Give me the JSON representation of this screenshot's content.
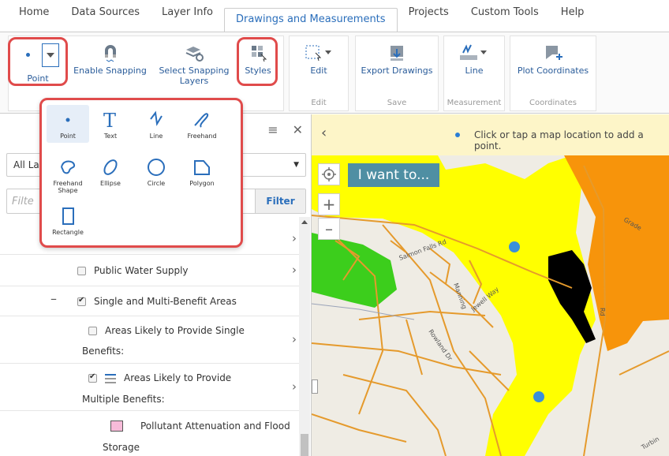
{
  "menu": {
    "tabs": [
      {
        "label": "Home"
      },
      {
        "label": "Data Sources"
      },
      {
        "label": "Layer Info"
      },
      {
        "label": "Drawings and Measurements"
      },
      {
        "label": "Projects"
      },
      {
        "label": "Custom Tools"
      },
      {
        "label": "Help"
      }
    ]
  },
  "ribbon": {
    "point_label": "Point",
    "enable_snapping_label": "Enable Snapping",
    "select_snapping_label": "Select Snapping Layers",
    "styles_label": "Styles",
    "edit_label": "Edit",
    "edit_group": "Edit",
    "export_label": "Export Drawings",
    "save_group": "Save",
    "line_label": "Line",
    "measurement_group": "Measurement",
    "plot_label": "Plot Coordinates",
    "coordinates_group": "Coordinates"
  },
  "drawing_tools": [
    {
      "label": "Point"
    },
    {
      "label": "Text"
    },
    {
      "label": "Line"
    },
    {
      "label": "Freehand"
    },
    {
      "label": "Freehand Shape"
    },
    {
      "label": "Ellipse"
    },
    {
      "label": "Circle"
    },
    {
      "label": "Polygon"
    },
    {
      "label": "Rectangle"
    }
  ],
  "panel": {
    "select_value": "All La",
    "filter_placeholder": "Filte",
    "filter_button": "Filter",
    "rows": [
      {
        "label": "Public Water Supply"
      },
      {
        "label": "Single and Multi-Benefit Areas"
      },
      {
        "label": "Areas Likely to Provide Single"
      },
      {
        "label": "Benefits:"
      },
      {
        "label": "Areas Likely to Provide"
      },
      {
        "label": "Multiple Benefits:"
      },
      {
        "label": "Pollutant Attenuation and Flood"
      },
      {
        "label": "Storage"
      }
    ]
  },
  "map": {
    "instruction": "Click or tap a map location to add a point.",
    "i_want_to": "I want to...",
    "road_labels": [
      "Salmon Falls Rd",
      "Grade",
      "Rd",
      "Rowland Dr",
      "Turbin",
      "Manning",
      "Jewell Way"
    ]
  },
  "colors": {
    "accent": "#2a6ebb",
    "highlight_ring": "#e04b4b",
    "yellow_layer": "#ffff00",
    "orange_layer": "#f7940b",
    "green_layer": "#3cce1c",
    "road": "#e59a2c",
    "legend_swatch": "#f7bbd9"
  }
}
